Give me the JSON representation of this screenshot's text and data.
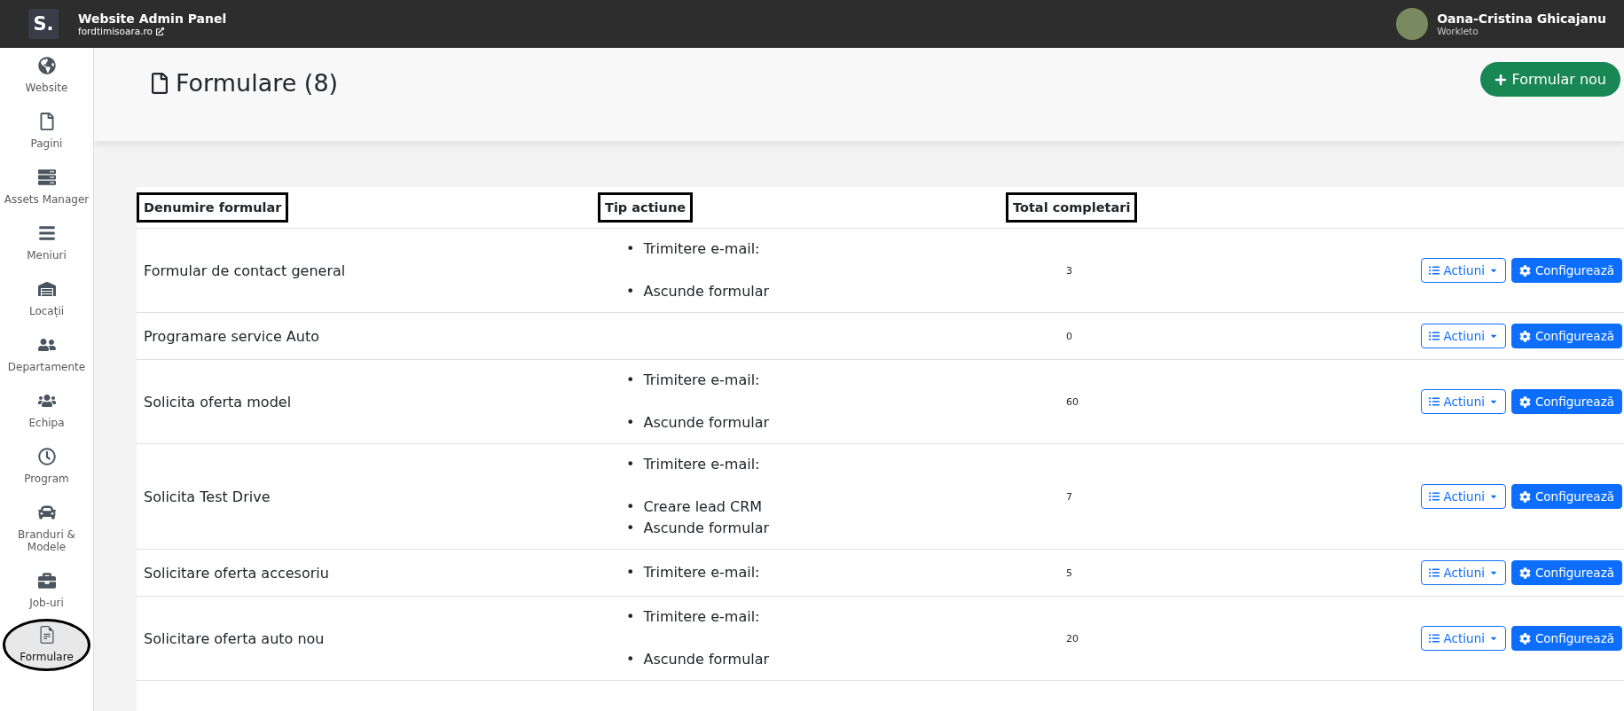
{
  "topbar": {
    "logo": "S.",
    "title": "Website Admin Panel",
    "site": "fordtimisoara.ro",
    "user_name": "Oana-Cristina Ghicajanu",
    "user_company": "Workleto"
  },
  "sidebar": {
    "items": [
      {
        "kind": "globe",
        "label": "Website",
        "selected": false,
        "circled": false
      },
      {
        "kind": "page",
        "label": "Pagini",
        "selected": false,
        "circled": false
      },
      {
        "kind": "server",
        "label": "Assets Manager",
        "selected": false,
        "circled": false
      },
      {
        "kind": "menu",
        "label": "Meniuri",
        "selected": false,
        "circled": false
      },
      {
        "kind": "warehouse",
        "label": "Locații",
        "selected": false,
        "circled": false
      },
      {
        "kind": "users",
        "label": "Departamente",
        "selected": false,
        "circled": false
      },
      {
        "kind": "team",
        "label": "Echipa",
        "selected": false,
        "circled": false
      },
      {
        "kind": "clock",
        "label": "Program",
        "selected": false,
        "circled": false
      },
      {
        "kind": "car",
        "label": "Branduri & Modele",
        "selected": false,
        "circled": false
      },
      {
        "kind": "briefcase",
        "label": "Job-uri",
        "selected": false,
        "circled": false
      },
      {
        "kind": "form",
        "label": "Formulare",
        "selected": true,
        "circled": true
      }
    ]
  },
  "page": {
    "title": "Formulare (8)",
    "new_button": "Formular nou"
  },
  "table": {
    "columns": [
      {
        "label": "Denumire formular",
        "highlighted": true
      },
      {
        "label": "Tip actiune",
        "highlighted": true
      },
      {
        "label": "Total completari",
        "highlighted": true
      }
    ],
    "rows": [
      {
        "name": "Formular de contact general",
        "actions": [
          {
            "kind": "email",
            "bullet": "•",
            "label": "Trimitere e-mail:"
          },
          {
            "kind": "plain",
            "bullet": "•",
            "label": "Ascunde formular"
          }
        ],
        "total": "3",
        "actions_button": "Actiuni",
        "configure_button": "Configurează"
      },
      {
        "name": "Programare service Auto",
        "actions": [],
        "total": "0",
        "actions_button": "Actiuni",
        "configure_button": "Configurează"
      },
      {
        "name": "Solicita oferta model",
        "actions": [
          {
            "kind": "email",
            "bullet": "•",
            "label": "Trimitere e-mail:"
          },
          {
            "kind": "plain",
            "bullet": "•",
            "label": "Ascunde formular"
          }
        ],
        "total": "60",
        "actions_button": "Actiuni",
        "configure_button": "Configurează"
      },
      {
        "name": "Solicita Test Drive",
        "actions": [
          {
            "kind": "email",
            "bullet": "•",
            "label": "Trimitere e-mail:"
          },
          {
            "kind": "plain",
            "bullet": "•",
            "label": "Creare lead CRM"
          },
          {
            "kind": "plain",
            "bullet": "•",
            "label": "Ascunde formular"
          }
        ],
        "total": "7",
        "actions_button": "Actiuni",
        "configure_button": "Configurează"
      },
      {
        "name": "Solicitare oferta accesoriu",
        "actions": [
          {
            "kind": "plain",
            "bullet": "•",
            "label": "Trimitere e-mail:"
          }
        ],
        "total": "5",
        "actions_button": "Actiuni",
        "configure_button": "Configurează"
      },
      {
        "name": "Solicitare oferta auto nou",
        "actions": [
          {
            "kind": "email",
            "bullet": "•",
            "label": "Trimitere e-mail:"
          },
          {
            "kind": "plain",
            "bullet": "•",
            "label": "Ascunde formular"
          }
        ],
        "total": "20",
        "actions_button": "Actiuni",
        "configure_button": "Configurează"
      }
    ]
  }
}
